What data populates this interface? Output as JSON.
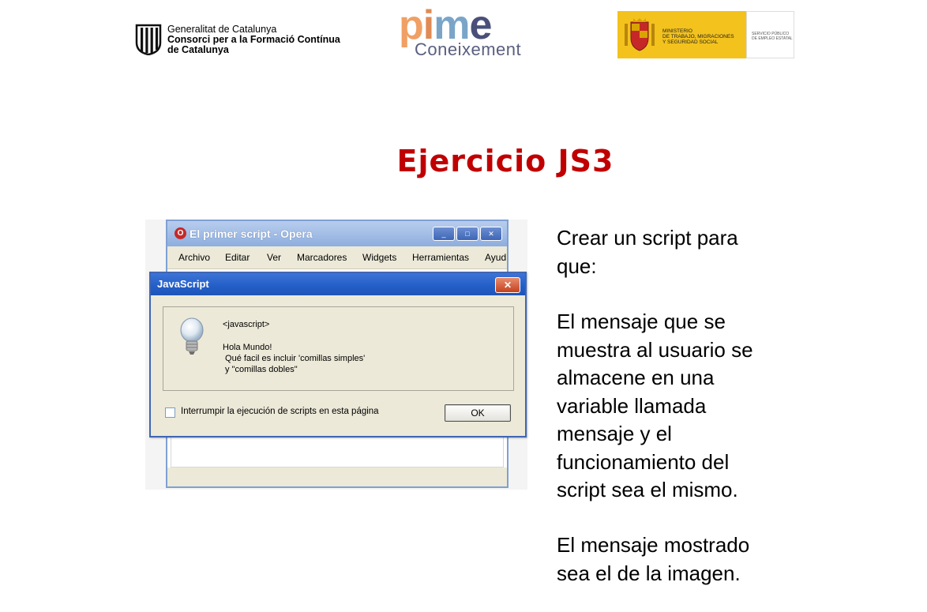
{
  "header": {
    "gencat": {
      "line1": "Generalitat de Catalunya",
      "line2": "Consorci per a la Formació Contínua",
      "line3": "de Catalunya"
    },
    "pime": {
      "word_p": "p",
      "word_i": "i",
      "word_m": "m",
      "word_e": "e",
      "subtitle": "Coneixement"
    },
    "ministerio": {
      "line1": "MINISTERIO",
      "line2": "DE TRABAJO, MIGRACIONES",
      "line3": "Y SEGURIDAD SOCIAL",
      "service_line1": "SERVICIO PÚBLICO",
      "service_line2": "DE EMPLEO ESTATAL"
    }
  },
  "slide": {
    "title": "Ejercicio JS3",
    "paragraph1_lines": [
      "Crear un script para",
      "que:"
    ],
    "paragraph2_lines": [
      "El mensaje que se",
      "muestra al usuario se",
      "almacene en una",
      "variable llamada",
      "mensaje y el",
      "funcionamiento del",
      "script sea el mismo."
    ],
    "paragraph3_lines": [
      "El mensaje mostrado",
      "sea el de la imagen."
    ]
  },
  "browser": {
    "title": "El primer script - Opera",
    "icon_letter": "O",
    "controls": {
      "minimize": "_",
      "maximize": "□",
      "close": "✕"
    },
    "menu": [
      "Archivo",
      "Editar",
      "Ver",
      "Marcadores",
      "Widgets",
      "Herramientas",
      "Ayud"
    ]
  },
  "dialog": {
    "title": "JavaScript",
    "close_symbol": "✕",
    "tag_line": "<javascript>",
    "message": "Hola Mundo!\n Qué facil es incluir 'comillas simples'\n y \"comillas dobles\"",
    "checkbox_label": "Interrumpir la ejecución de scripts en esta página",
    "ok_label": "OK"
  },
  "colors": {
    "title_red": "#c00000",
    "xp_blue": "#235ec7",
    "dialog_bg": "#ece9d8",
    "ministerio_yellow": "#f3c21d"
  },
  "icons": [
    "gencat-emblem-icon",
    "spain-coat-of-arms-icon",
    "opera-icon",
    "lightbulb-icon"
  ]
}
